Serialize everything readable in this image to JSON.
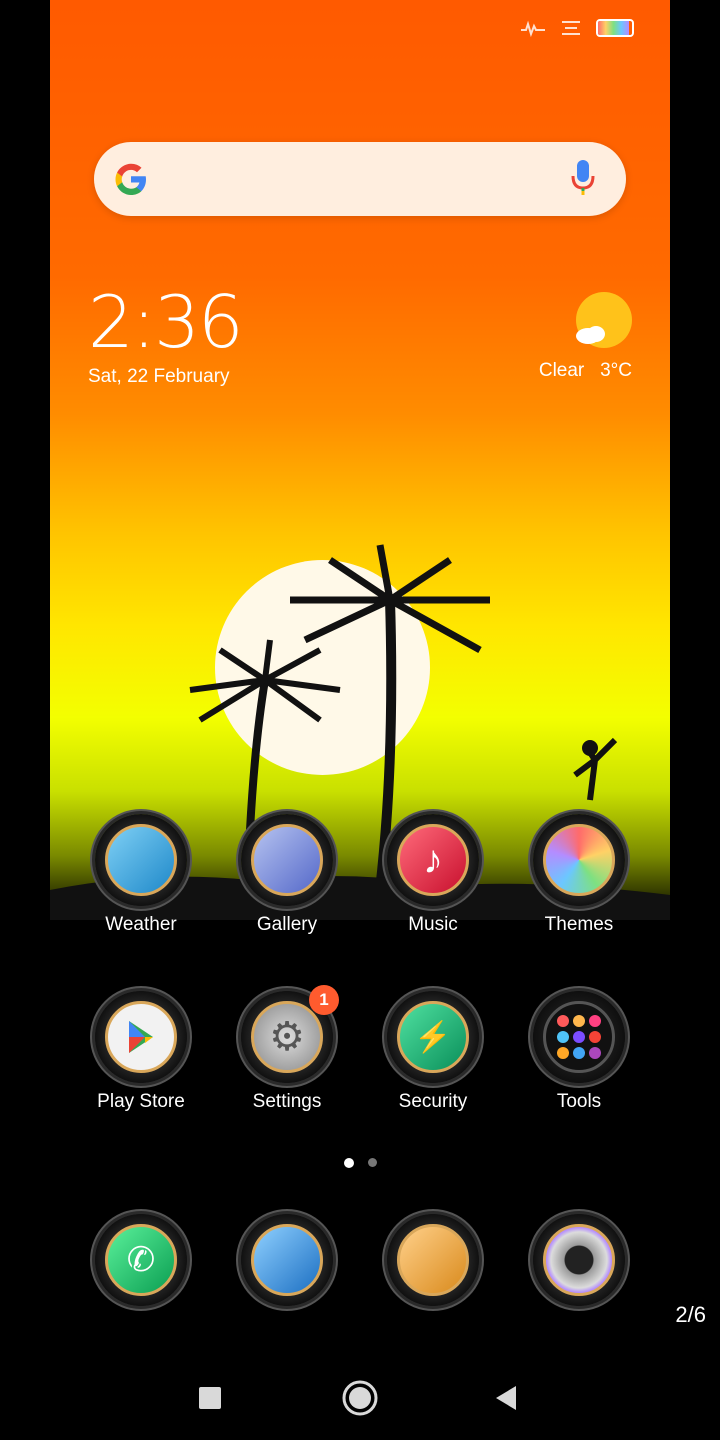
{
  "status_bar": {
    "icons": [
      "signal-activity-icon",
      "notification-lines-icon",
      "battery-icon"
    ],
    "battery_colors": [
      "#ff6b6b",
      "#ffd166",
      "#7ee081",
      "#6bc7ff",
      "#b48cff"
    ]
  },
  "search": {
    "icon": "google-icon",
    "mic": "mic-icon",
    "background": "#fff3ea"
  },
  "clock": {
    "time": "2:36",
    "date": "Sat, 22 February"
  },
  "weather": {
    "condition": "Clear",
    "temperature": "3°C",
    "icon": "sun-cloud-icon"
  },
  "wallpaper": {
    "colors": [
      "#ff5a00",
      "#ff8c00",
      "#ffc400",
      "#f3ff00"
    ]
  },
  "apps_row1": [
    {
      "label": "Weather",
      "icon": "weather-icon"
    },
    {
      "label": "Gallery",
      "icon": "gallery-icon"
    },
    {
      "label": "Music",
      "icon": "music-icon"
    },
    {
      "label": "Themes",
      "icon": "themes-icon"
    }
  ],
  "apps_row2": [
    {
      "label": "Play Store",
      "icon": "play-store-icon"
    },
    {
      "label": "Settings",
      "icon": "settings-icon",
      "badge": "1"
    },
    {
      "label": "Security",
      "icon": "security-icon"
    },
    {
      "label": "Tools",
      "icon": "tools-folder-icon"
    }
  ],
  "dock": [
    {
      "icon": "phone-icon"
    },
    {
      "icon": "browser-icon"
    },
    {
      "icon": "messages-icon"
    },
    {
      "icon": "camera-icon"
    }
  ],
  "page_indicator": {
    "pages": 2,
    "active": 1
  },
  "page_counter": "2/6",
  "nav": {
    "buttons": [
      "recents-button",
      "home-button",
      "back-button"
    ]
  }
}
